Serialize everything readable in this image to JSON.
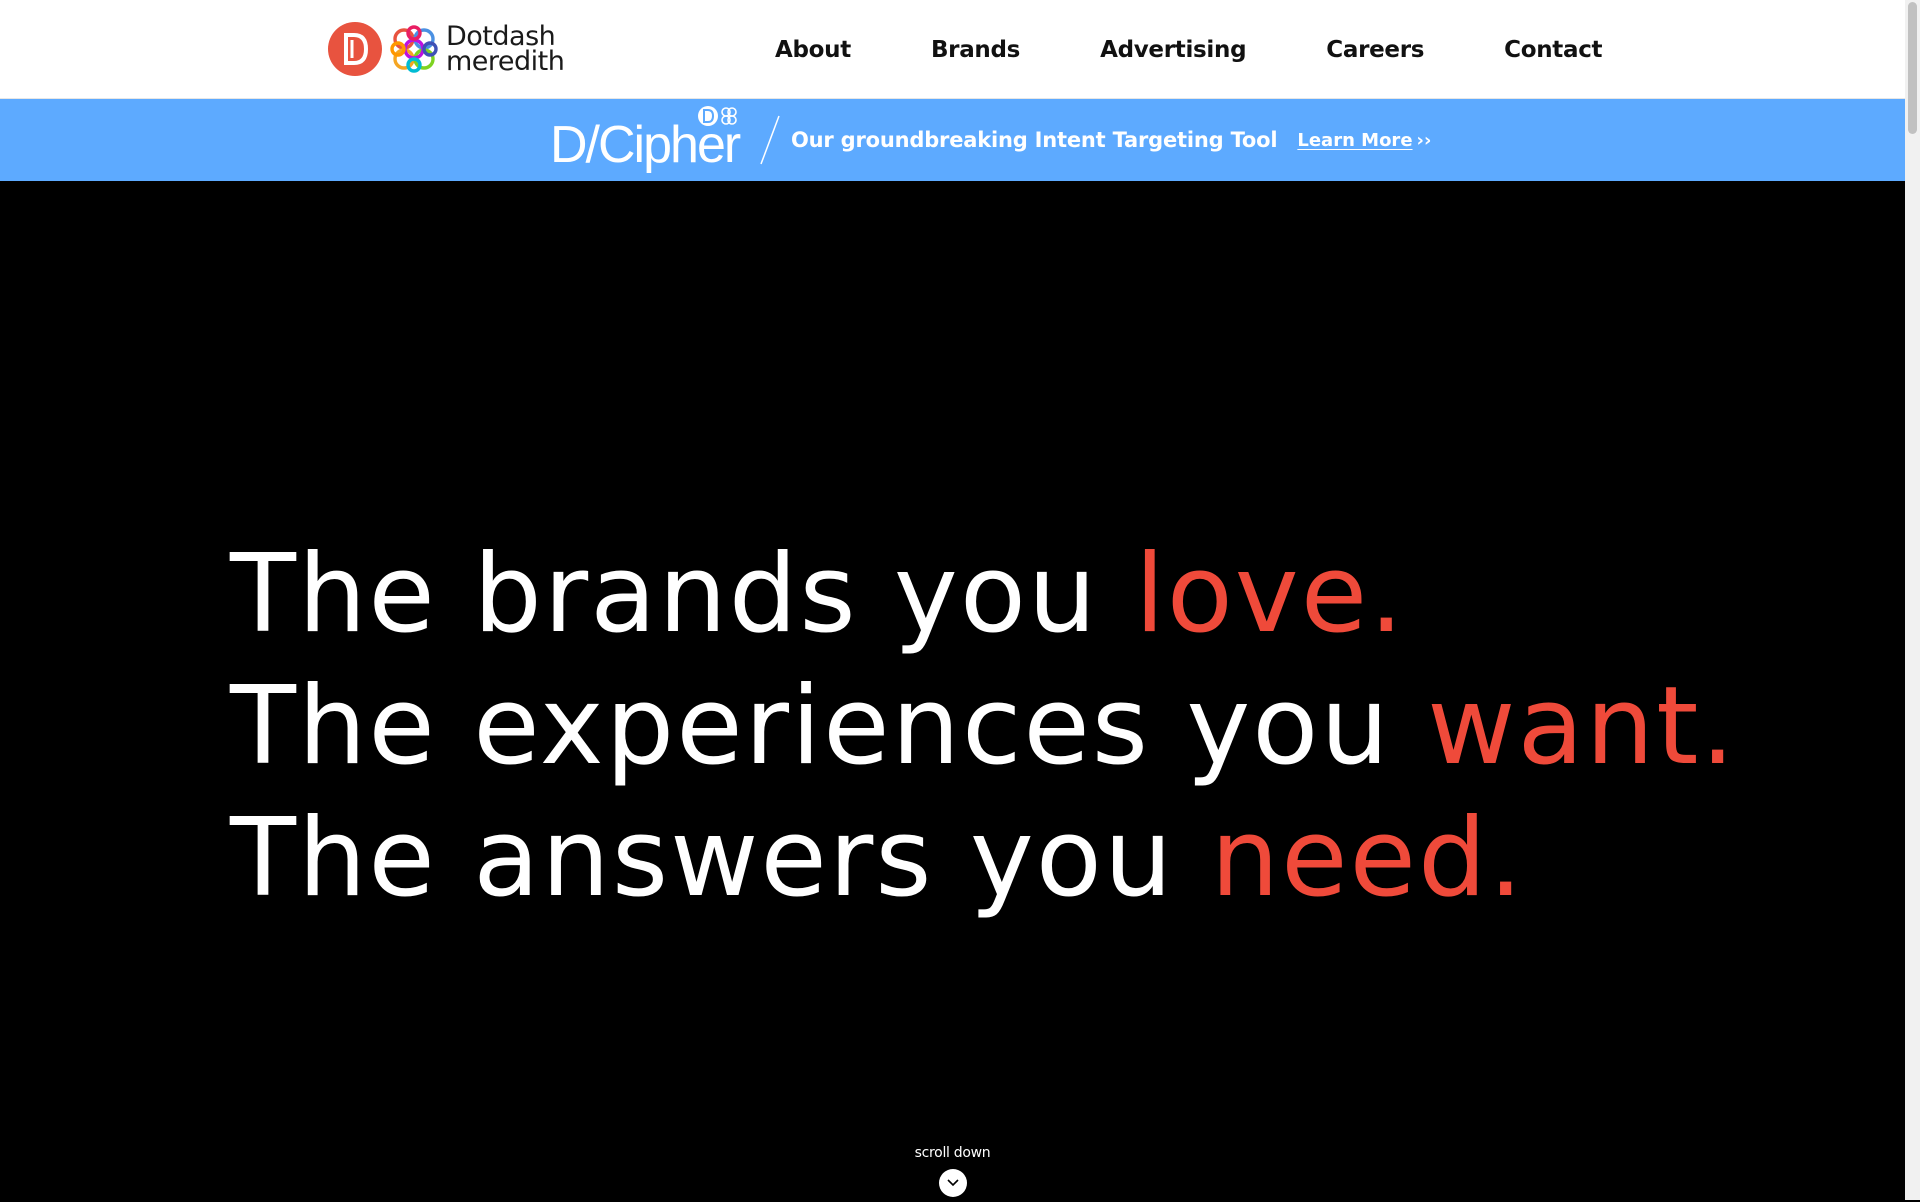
{
  "header": {
    "logo": {
      "line1": "Dotdash",
      "line2": "meredith"
    },
    "nav": [
      {
        "label": "About"
      },
      {
        "label": "Brands"
      },
      {
        "label": "Advertising"
      },
      {
        "label": "Careers"
      },
      {
        "label": "Contact"
      }
    ]
  },
  "promo": {
    "logo_text": "D/Cipher",
    "text": "Our groundbreaking Intent Targeting Tool",
    "link_label": "Learn More",
    "link_arrows": "››",
    "background": "#5daaff"
  },
  "hero": {
    "lines": [
      {
        "prefix": "The brands you ",
        "accent": "love."
      },
      {
        "prefix": "The experiences you ",
        "accent": "want."
      },
      {
        "prefix": "The answers you ",
        "accent": "need."
      }
    ],
    "accent_color": "#ef4a3a",
    "scroll_label": "scroll down",
    "scroll_icon": "chevron-down-icon"
  },
  "colors": {
    "brand_red": "#e8533f",
    "hero_background": "#000000"
  }
}
